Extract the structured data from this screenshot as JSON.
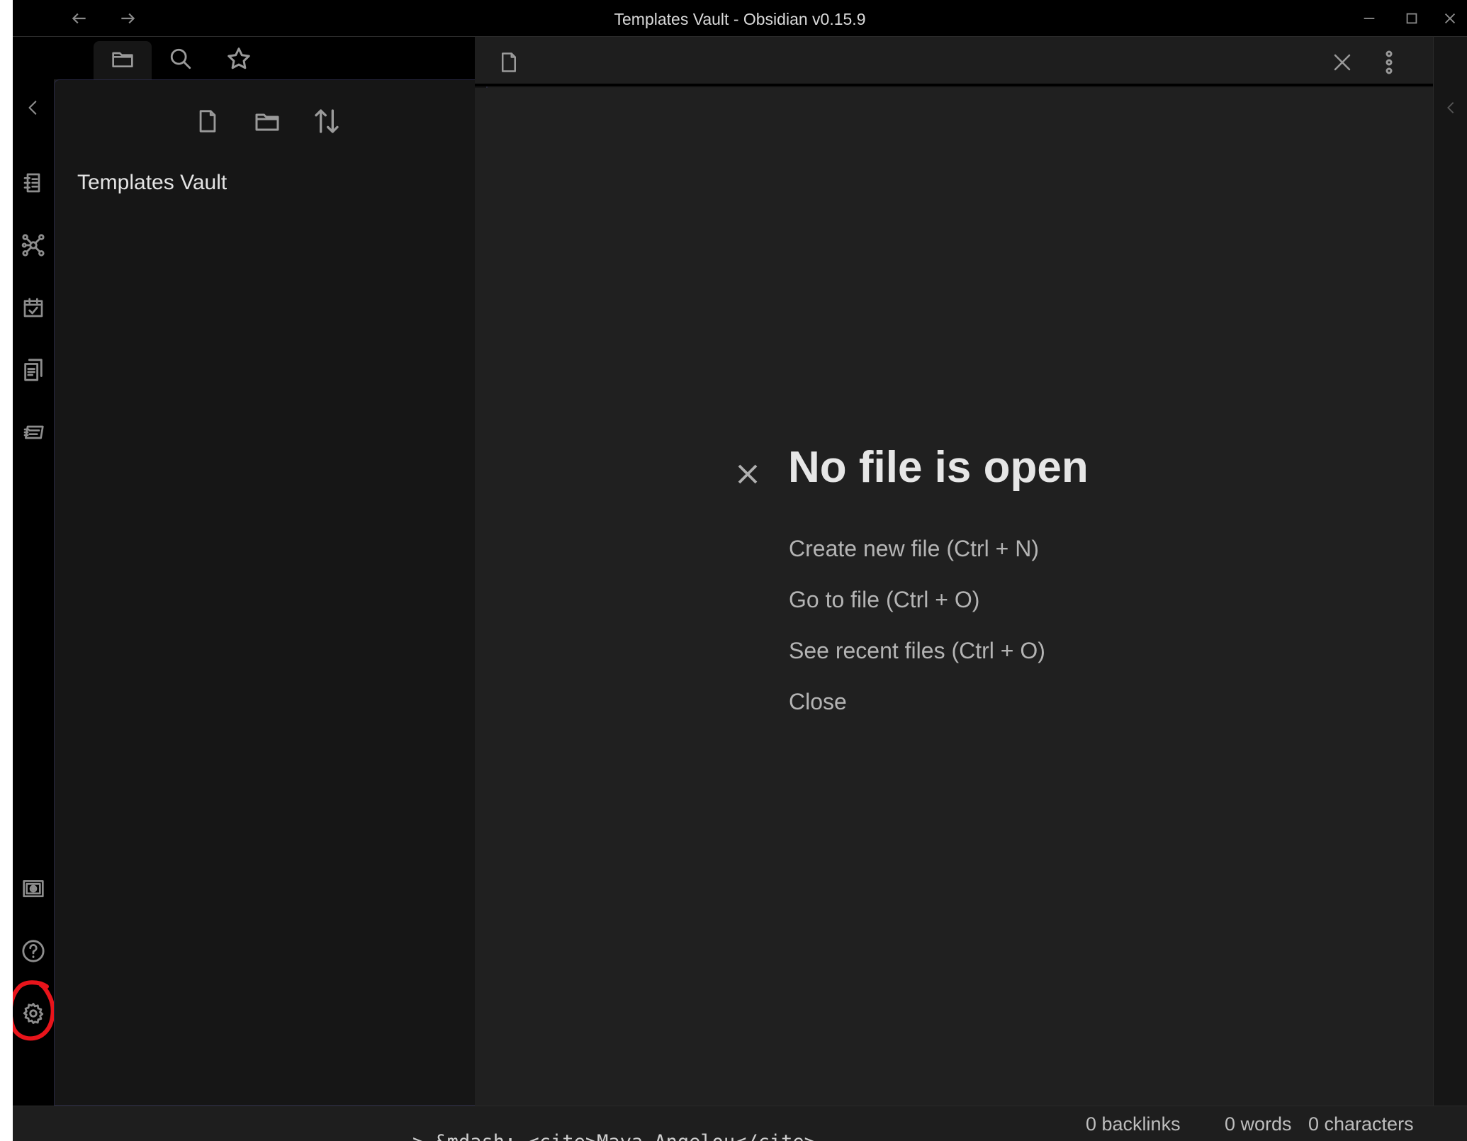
{
  "window": {
    "title": "Templates Vault - Obsidian v0.15.9"
  },
  "titlebar": {
    "back_icon": "arrow-left-icon",
    "forward_icon": "arrow-right-icon",
    "minimize_icon": "minimize-icon",
    "maximize_icon": "maximize-icon",
    "close_icon": "close-icon"
  },
  "ribbon": {
    "items": [
      {
        "icon": "collapse-left-icon"
      },
      {
        "icon": "quick-switcher-icon"
      },
      {
        "icon": "graph-view-icon"
      },
      {
        "icon": "daily-note-icon"
      },
      {
        "icon": "insert-template-icon"
      },
      {
        "icon": "slides-icon"
      },
      {
        "icon": "open-vault-icon"
      },
      {
        "icon": "help-icon"
      },
      {
        "icon": "settings-icon"
      }
    ],
    "annotation_color": "#e8141b"
  },
  "sidebar": {
    "tabs": [
      {
        "icon": "folder-icon",
        "active": true
      },
      {
        "icon": "search-icon",
        "active": false
      },
      {
        "icon": "star-icon",
        "active": false
      }
    ],
    "actions": [
      {
        "icon": "new-note-icon"
      },
      {
        "icon": "new-folder-icon"
      },
      {
        "icon": "sort-icon"
      }
    ],
    "vault_name": "Templates Vault"
  },
  "editor": {
    "header_icons": [
      "file-icon",
      "close-icon",
      "more-vertical-icon"
    ],
    "empty_state": {
      "title": "No file is open",
      "actions": [
        "Create new file (Ctrl + N)",
        "Go to file (Ctrl + O)",
        "See recent files (Ctrl + O)",
        "Close"
      ]
    }
  },
  "right_ribbon": {
    "icon": "expand-right-sidebar-icon"
  },
  "statusbar": {
    "backlinks": "0 backlinks",
    "words": "0 words",
    "characters": "0 characters"
  },
  "background_bleed": "> &mdash; <cite>Maya Angelou</cite>",
  "colors": {
    "ribbon_bg": "#000000",
    "explorer_bg": "#161616",
    "editor_bg": "#202020",
    "text": "#dadada"
  }
}
